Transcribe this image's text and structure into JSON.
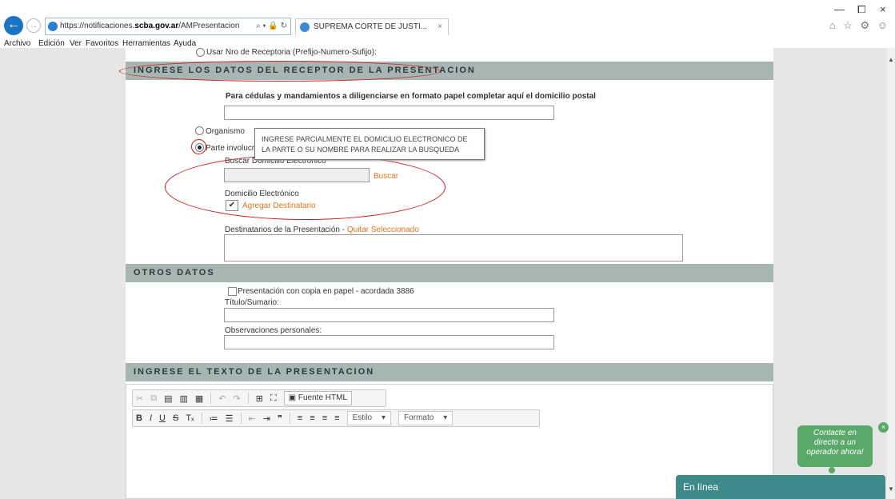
{
  "browser": {
    "url_prefix": "https://notificaciones.",
    "url_domain": "scba.gov.ar",
    "url_path": "/AMPresentacion",
    "url_controls": "⌕ ▾ 🔒 ↻",
    "tab_title": "SUPREMA CORTE DE JUSTI...",
    "tab_close": "×",
    "window_min": "—",
    "window_max": "⧠",
    "window_close": "×",
    "toolbar_icons": "⌂ ☆ ⚙ ☺",
    "back_glyph": "←",
    "forward_glyph": "→"
  },
  "menu": [
    "Archivo",
    "Edición",
    "Ver",
    "Favoritos",
    "Herramientas",
    "Ayuda"
  ],
  "form": {
    "cut_radio_label": "Usar Nro de Receptoria (Prefijo-Numero-Sufijo):",
    "section_receptor": "INGRESE LOS DATOS DEL RECEPTOR DE LA PRESENTACION",
    "postal_label": "Para cédulas y mandamientos a diligenciarse en formato papel completar aquí el domicilio postal",
    "radio_organismo": "Organismo",
    "radio_parte": "Parte involucrada",
    "tooltip": "INGRESE PARCIALMENTE EL DOMICILIO ELECTRONICO DE LA PARTE O SU NOMBRE PARA REALIZAR LA BUSQUEDA",
    "buscar_label": "Buscar Domicilio Electrónico",
    "buscar_link": "Buscar",
    "domicilio_label": "Domicilio Electrónico",
    "agregar_link": "Agregar Destinatario",
    "destinatarios_label": "Destinatarios de la Presentación",
    "destinatarios_sep": " - ",
    "quitar_link": "Quitar Seleccionado",
    "section_otros": "OTROS DATOS",
    "copia_label": "Presentación con copia en papel - acordada 3886",
    "titulo_label": "Título/Sumario:",
    "observaciones_label": "Observaciones personales:",
    "section_texto": "INGRESE EL TEXTO DE LA PRESENTACION"
  },
  "editor": {
    "source_label": "Fuente HTML",
    "style_label": "Estilo",
    "format_label": "Formato"
  },
  "chat": {
    "bubble_line1": "Contacte en",
    "bubble_line2": "directo a un",
    "bubble_line3": "operador ahora!",
    "close": "×",
    "bar_label": "En línea"
  },
  "colors": {
    "section_bg": "#a7b5b3",
    "link_orange": "#e8761a",
    "annotation_red": "#d01c1c",
    "chat_green": "#5aa96b",
    "chat_teal": "#3e8a8a"
  }
}
